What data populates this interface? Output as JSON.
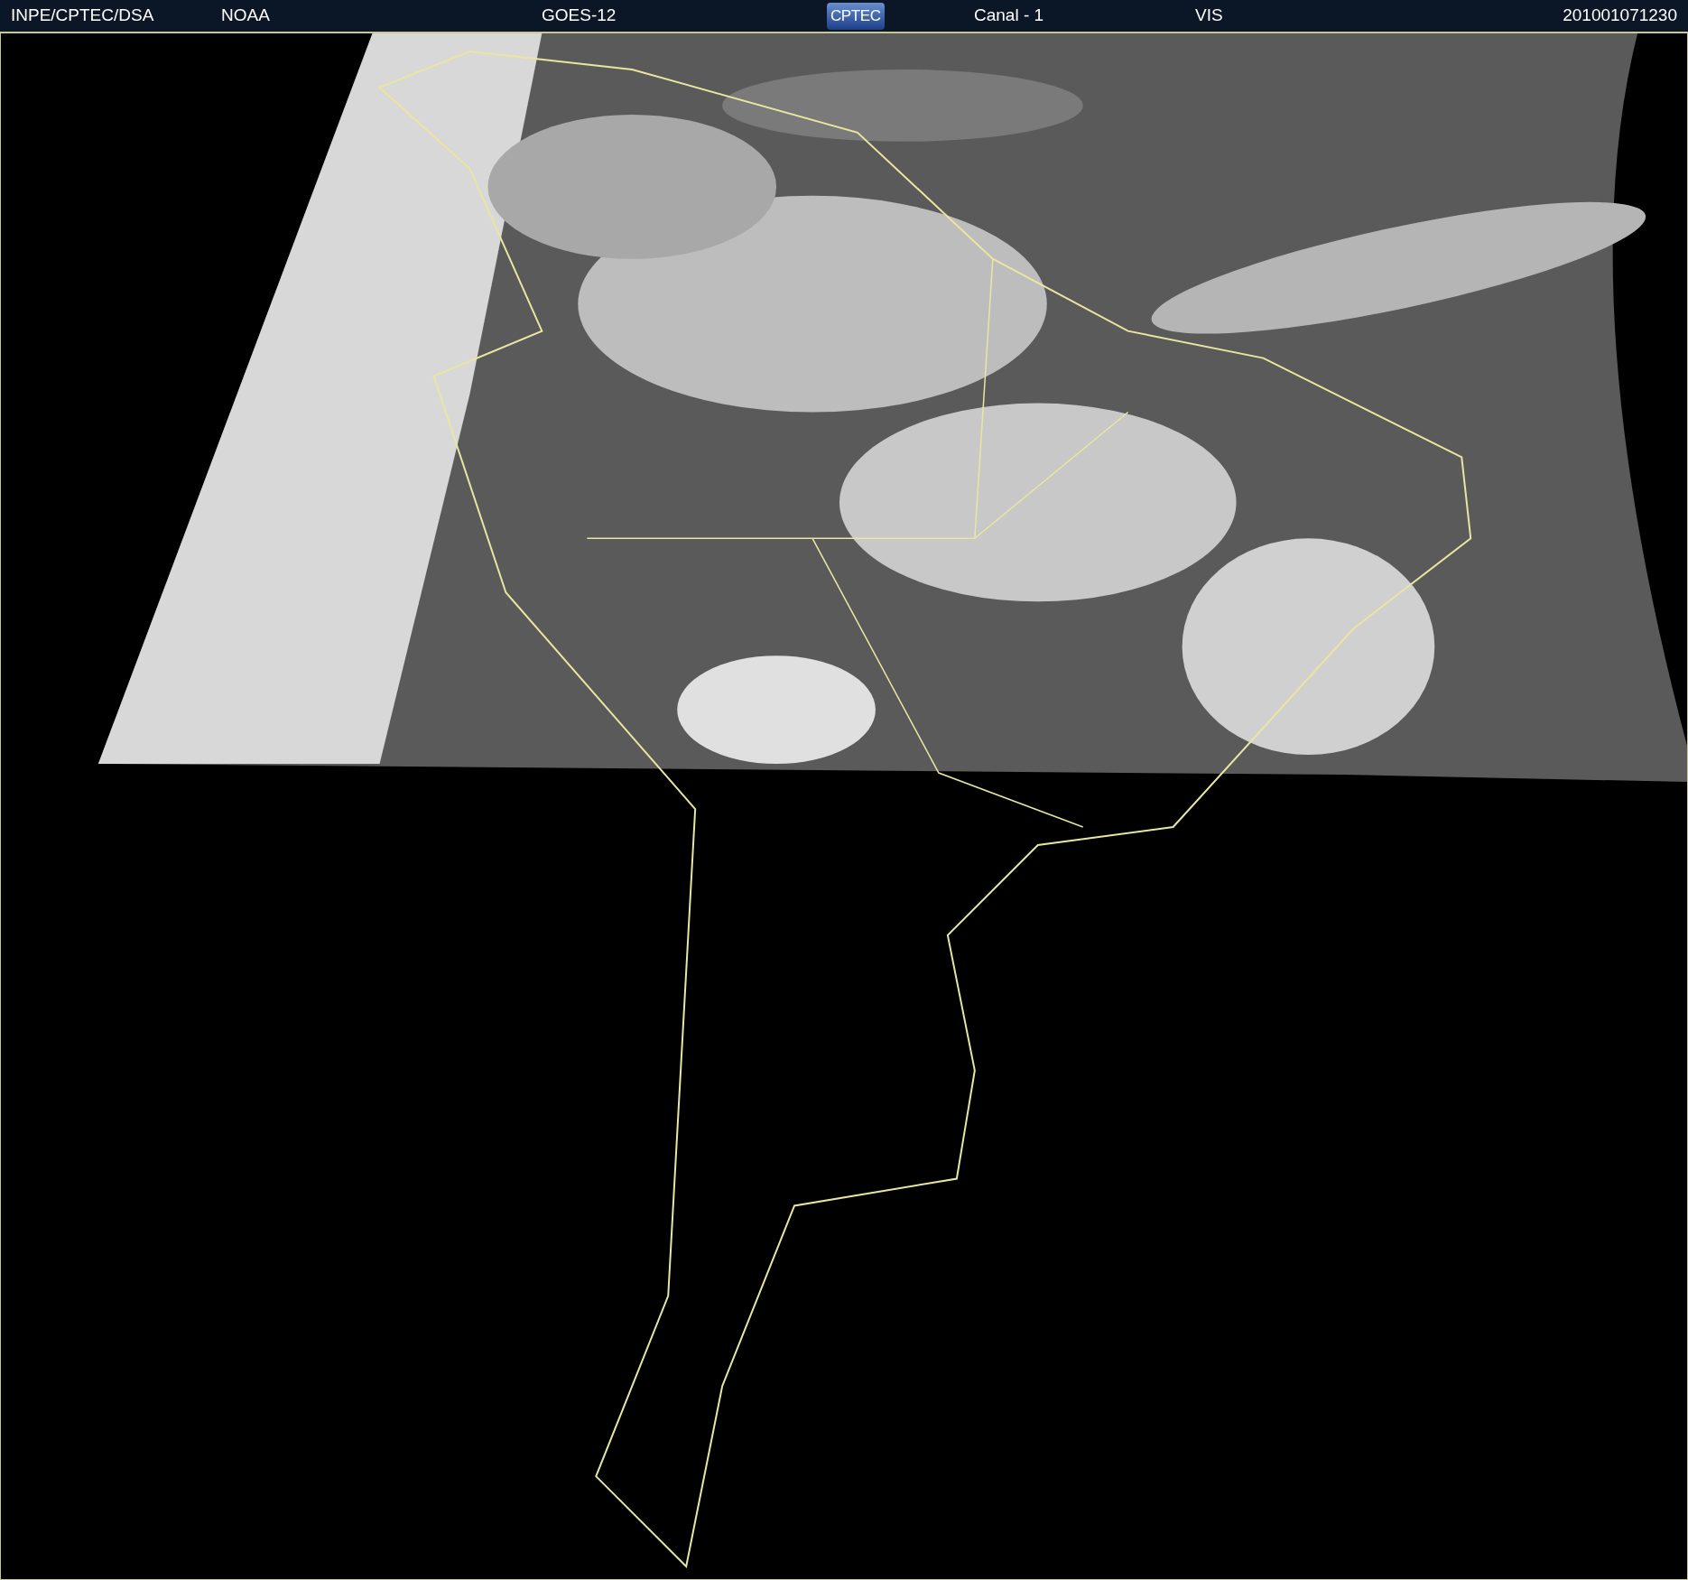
{
  "header": {
    "items": [
      {
        "kind": "text",
        "text": "INPE/CPTEC/DSA"
      },
      {
        "kind": "text",
        "text": "NOAA"
      },
      {
        "kind": "text",
        "text": "GOES-12"
      },
      {
        "kind": "logo",
        "text": "CPTEC"
      },
      {
        "kind": "text",
        "text": "Canal - 1"
      },
      {
        "kind": "text",
        "text": "VIS"
      },
      {
        "kind": "text",
        "text": "201001071230"
      }
    ]
  }
}
